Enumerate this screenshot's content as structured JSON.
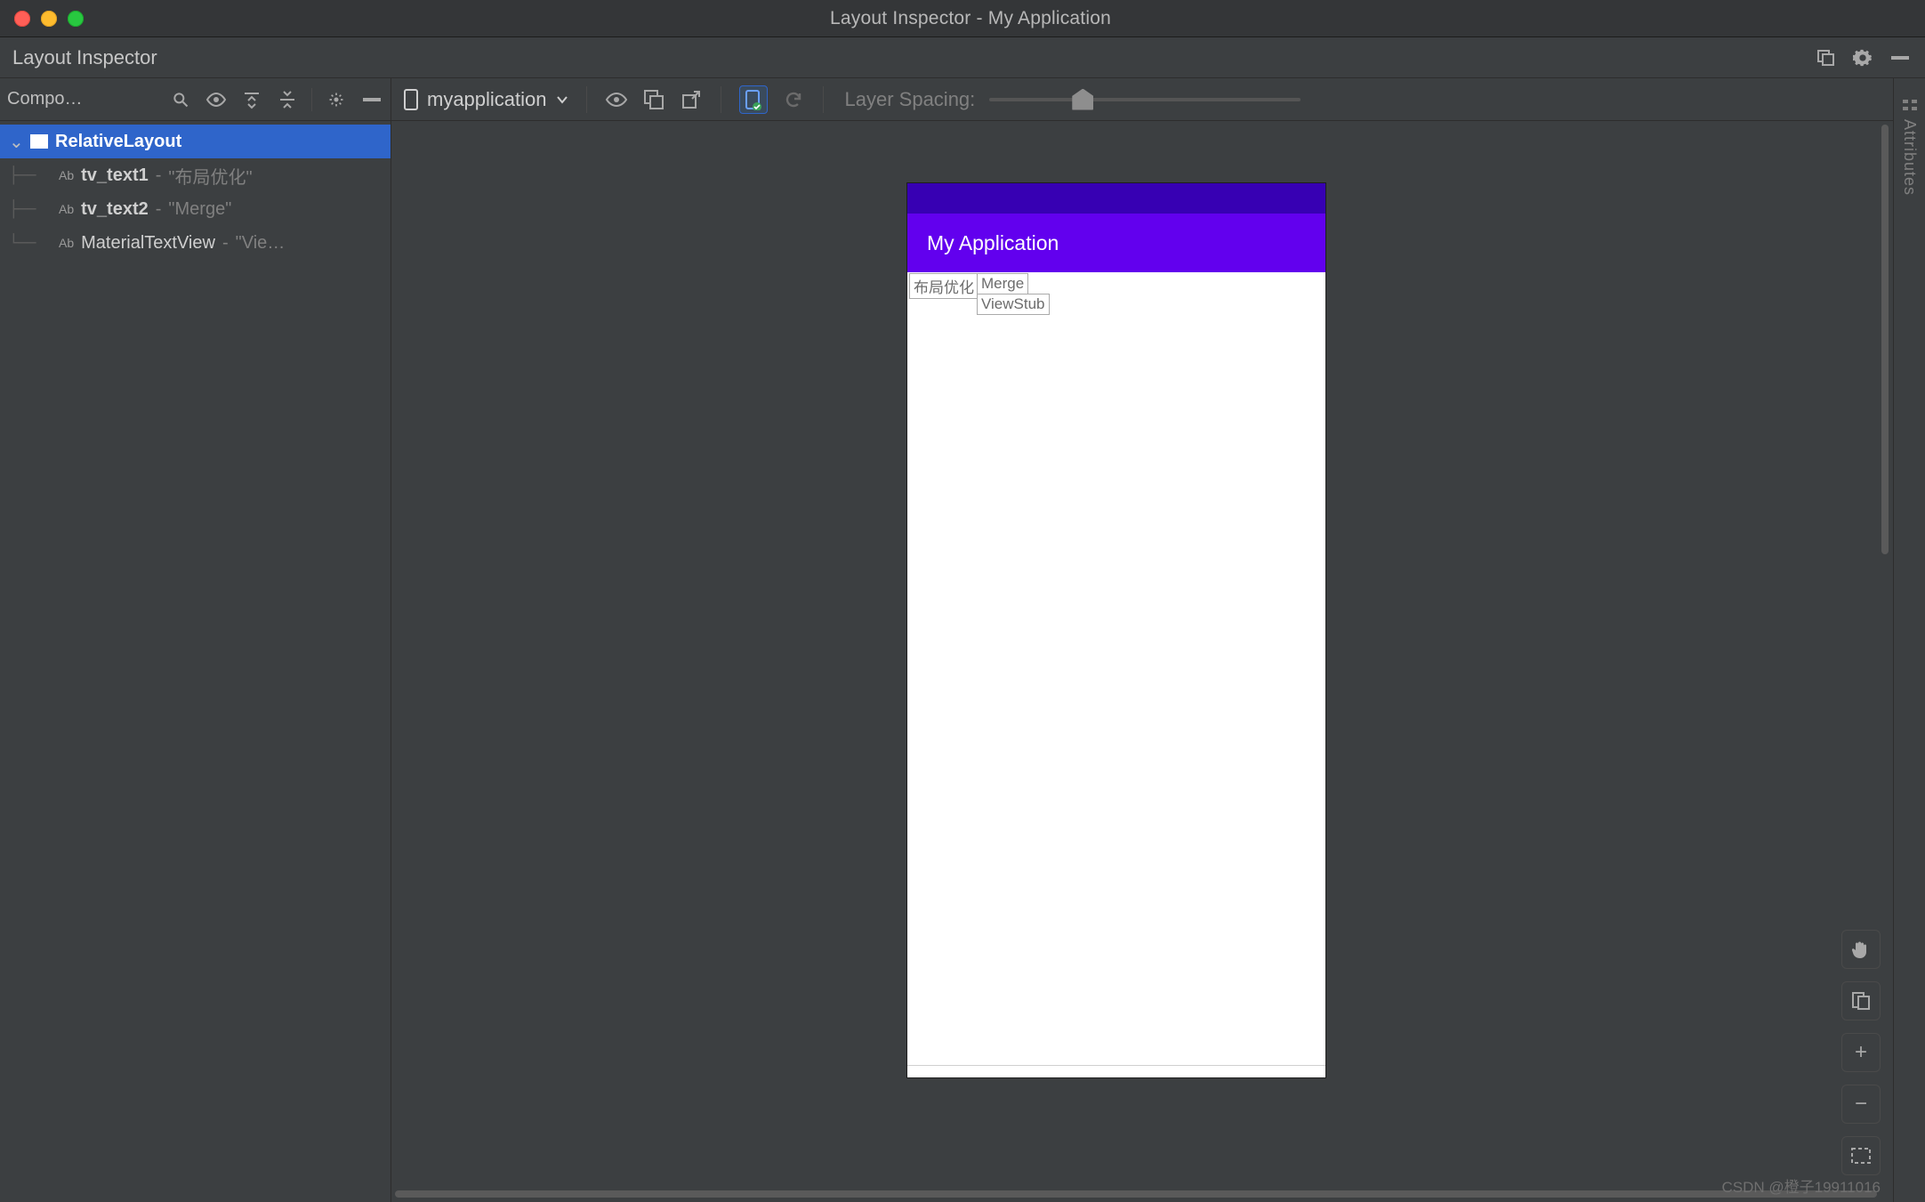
{
  "window": {
    "title": "Layout Inspector - My Application"
  },
  "toolwindow": {
    "title": "Layout Inspector"
  },
  "sidebar": {
    "panel_label": "Compo…",
    "tree": [
      {
        "chev": "⌄",
        "icon": "layout",
        "name": "RelativeLayout",
        "value": "",
        "selected": true,
        "depth": 0
      },
      {
        "kind": "Ab",
        "name": "tv_text1",
        "bold": true,
        "value": "\"布局优化\"",
        "depth": 1
      },
      {
        "kind": "Ab",
        "name": "tv_text2",
        "bold": true,
        "value": "\"Merge\"",
        "depth": 1
      },
      {
        "kind": "Ab",
        "name": "MaterialTextView",
        "bold": false,
        "value": "\"Vie…",
        "depth": 1,
        "last": true
      }
    ]
  },
  "canvas": {
    "device_name": "myapplication",
    "layer_spacing_label": "Layer Spacing:"
  },
  "phone": {
    "app_title": "My Application",
    "cells": [
      "布局优化",
      "Merge",
      "ViewStub"
    ]
  },
  "attributes": {
    "tab_label": "Attributes"
  },
  "watermark": "CSDN @橙子19911016"
}
